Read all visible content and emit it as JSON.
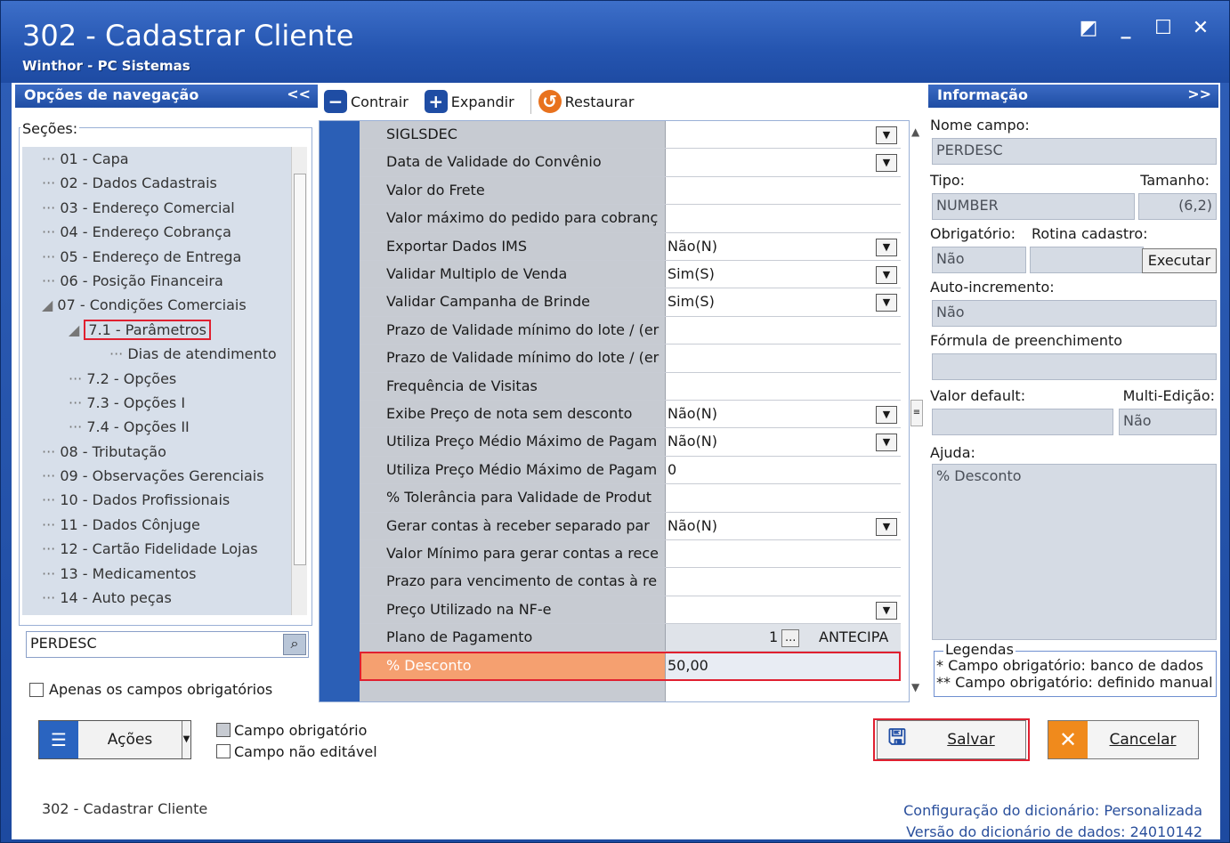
{
  "window": {
    "title": "302 - Cadastrar Cliente",
    "subtitle": "Winthor - PC Sistemas",
    "controls": [
      "◩",
      "_",
      "☐",
      "✕"
    ]
  },
  "nav": {
    "header": "Opções de navegação",
    "collapse": "<<",
    "sections_label": "Seções:",
    "items": [
      {
        "label": "01 - Capa",
        "level": 1
      },
      {
        "label": "02 - Dados Cadastrais",
        "level": 1
      },
      {
        "label": "03 - Endereço Comercial",
        "level": 1
      },
      {
        "label": "04 - Endereço Cobrança",
        "level": 1
      },
      {
        "label": "05 - Endereço de Entrega",
        "level": 1
      },
      {
        "label": "06 - Posição Financeira",
        "level": 1
      },
      {
        "label": "07 - Condições Comerciais",
        "level": 1
      },
      {
        "label": "7.1 - Parâmetros",
        "level": 2
      },
      {
        "label": "Dias de atendimento",
        "level": 3
      },
      {
        "label": "7.2 - Opções",
        "level": 2
      },
      {
        "label": "7.3 - Opções I",
        "level": 2
      },
      {
        "label": "7.4 - Opções II",
        "level": 2
      },
      {
        "label": "08 - Tributação",
        "level": 1
      },
      {
        "label": "09 - Observações Gerenciais",
        "level": 1
      },
      {
        "label": "10 - Dados Profissionais",
        "level": 1
      },
      {
        "label": "11 - Dados Cônjuge",
        "level": 1
      },
      {
        "label": "12 - Cartão Fidelidade Lojas",
        "level": 1
      },
      {
        "label": "13 - Medicamentos",
        "level": 1
      },
      {
        "label": "14 - Auto peças",
        "level": 1
      }
    ],
    "search_value": "PERDESC",
    "only_required_label": "Apenas os campos obrigatórios"
  },
  "toolbar": {
    "collapse_label": "Contrair",
    "expand_label": "Expandir",
    "restore_label": "Restaurar"
  },
  "grid": {
    "rows": [
      {
        "label": "SIGLSDEC",
        "value": "",
        "dropdown": true
      },
      {
        "label": "Data de Validade do Convênio",
        "value": "",
        "dropdown": true
      },
      {
        "label": "Valor do Frete",
        "value": "",
        "dropdown": false
      },
      {
        "label": "Valor máximo do pedido para cobranç",
        "value": "",
        "dropdown": false
      },
      {
        "label": "Exportar Dados IMS",
        "value": "Não(N)",
        "dropdown": true
      },
      {
        "label": "Validar Multiplo de Venda",
        "value": "Sim(S)",
        "dropdown": true
      },
      {
        "label": "Validar Campanha de Brinde",
        "value": "Sim(S)",
        "dropdown": true
      },
      {
        "label": "Prazo de Validade mínimo do lote / (er",
        "value": "",
        "dropdown": false
      },
      {
        "label": "Prazo de Validade mínimo do lote / (er",
        "value": "",
        "dropdown": false
      },
      {
        "label": "Frequência de Visitas",
        "value": "",
        "dropdown": false
      },
      {
        "label": "Exibe Preço de nota sem desconto",
        "value": "Não(N)",
        "dropdown": true
      },
      {
        "label": "Utiliza Preço Médio Máximo de Pagam",
        "value": "Não(N)",
        "dropdown": true
      },
      {
        "label": "Utiliza Preço Médio Máximo de Pagam",
        "value": "0",
        "dropdown": false
      },
      {
        "label": "% Tolerância para Validade de Produt",
        "value": "",
        "dropdown": false
      },
      {
        "label": "Gerar contas à receber separado par",
        "value": "Não(N)",
        "dropdown": true
      },
      {
        "label": "Valor Mínimo para gerar contas a rece",
        "value": "",
        "dropdown": false
      },
      {
        "label": "Prazo para vencimento de contas à re",
        "value": "",
        "dropdown": false
      },
      {
        "label": "Preço Utilizado na NF-e",
        "value": "",
        "dropdown": true
      }
    ],
    "plan_label": "Plano de Pagamento",
    "plan_code": "1",
    "plan_button": "...",
    "plan_name": "ANTECIPA",
    "selected_label": "% Desconto",
    "selected_value": "50,00"
  },
  "info": {
    "header": "Informação",
    "expand": ">>",
    "field_name_label": "Nome campo:",
    "field_name": "PERDESC",
    "type_label": "Tipo:",
    "size_label": "Tamanho:",
    "type": "NUMBER",
    "size": "(6,2)",
    "required_label": "Obrigatório:",
    "routine_label": "Rotina cadastro:",
    "required": "Não",
    "routine": "",
    "execute_label": "Executar",
    "autoinc_label": "Auto-incremento:",
    "autoinc": "Não",
    "formula_label": "Fórmula de preenchimento",
    "formula": "",
    "default_label": "Valor default:",
    "multi_label": "Multi-Edição:",
    "default": "",
    "multi": "Não",
    "help_label": "Ajuda:",
    "help": "% Desconto",
    "legend_title": "Legendas",
    "legend_1": "* Campo obrigatório: banco de dados",
    "legend_2": "** Campo obrigatório: definido manual"
  },
  "footer": {
    "actions_label": "Ações",
    "legend_required": "Campo obrigatório",
    "legend_not_editable": "Campo não editável",
    "save_label": "Salvar",
    "cancel_label": "Cancelar",
    "status_left": "302 - Cadastrar Cliente",
    "dict_config_label": "Configuração do dicionário:",
    "dict_config": "Personalizada",
    "dict_version_label": "Versão do dicionário de dados:",
    "dict_version": "24010142"
  }
}
